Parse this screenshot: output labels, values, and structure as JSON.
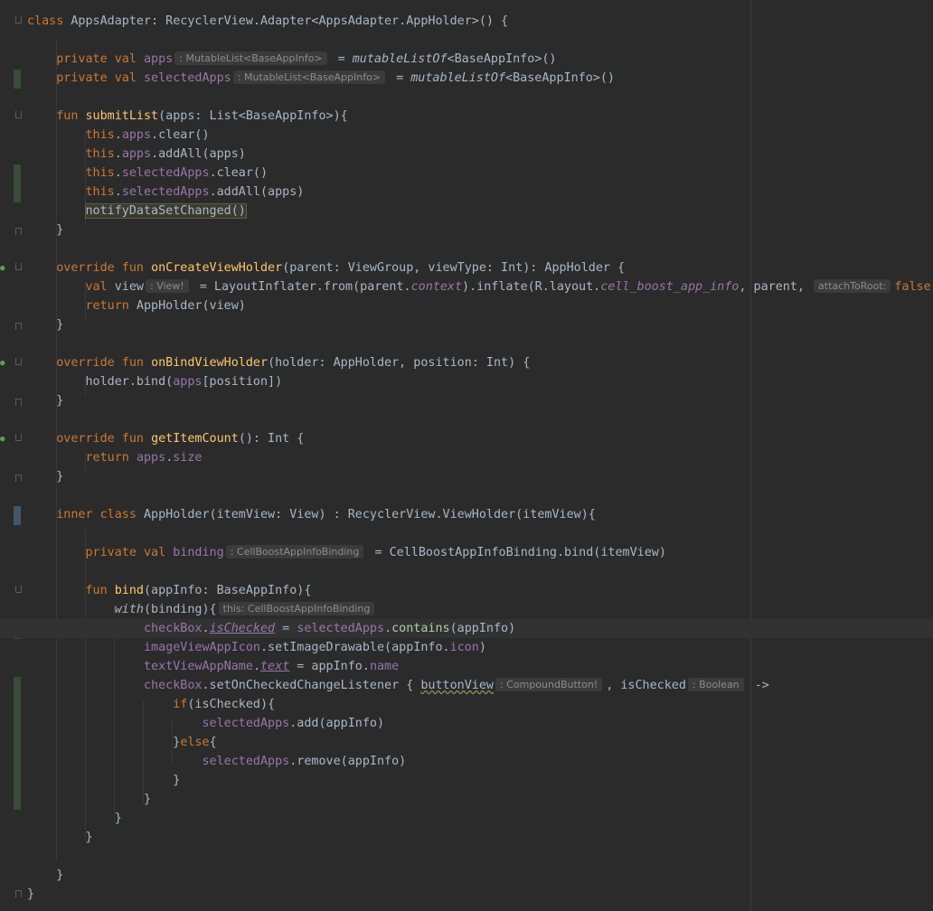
{
  "editor": {
    "title": "",
    "theme_colors": {
      "background": "#2b2b2b",
      "keyword": "#cc7832",
      "function": "#ffc66d",
      "property": "#9876aa",
      "text": "#a9b7c6",
      "hint_bg": "#3b3b3b",
      "vcs_added": "#384c38"
    }
  },
  "hints": {
    "apps_type": ": MutableList<BaseAppInfo>",
    "selected_type": ": MutableList<BaseAppInfo>",
    "view_type": ": View!",
    "attach_to_root": "attachToRoot:",
    "binding_type": ": CellBoostAppInfoBinding",
    "this_type": "this: CellBoostAppInfoBinding",
    "button_view_type": ": CompoundButton!",
    "is_checked_type": ": Boolean"
  },
  "text": {
    "l1_class": "class ",
    "l1_rest": "AppsAdapter: RecyclerView.Adapter<AppsAdapter.AppHolder>() {",
    "l3_priv": "private val ",
    "l3_name": "apps",
    "l3_eq": " = ",
    "l3_call": "mutableListOf",
    "l3_end": "<BaseAppInfo>()",
    "l4_priv": "private val ",
    "l4_name": "selectedApps",
    "l4_eq": " = ",
    "l4_call": "mutableListOf",
    "l4_end": "<BaseAppInfo>()",
    "l6_fun": "fun ",
    "l6_name": "submitList",
    "l6_rest": "(apps: List<BaseAppInfo>){",
    "l7_this": "this",
    "l7_dot": ".",
    "l7_prop": "apps",
    "l7_end": ".clear()",
    "l8_this": "this",
    "l8_dot": ".",
    "l8_prop": "apps",
    "l8_end": ".addAll(apps)",
    "l9_this": "this",
    "l9_dot": ".",
    "l9_prop": "selectedApps",
    "l9_end": ".clear()",
    "l10_this": "this",
    "l10_dot": ".",
    "l10_prop": "selectedApps",
    "l10_end": ".addAll(apps)",
    "l11_call": "notifyDataSetChanged()",
    "close": "}",
    "l14_kw": "override fun ",
    "l14_name": "onCreateViewHolder",
    "l14_rest": "(parent: ViewGroup, viewType: Int): AppHolder {",
    "l15_val": "val ",
    "l15_name": "view",
    "l15_a": " = LayoutInflater.from(parent.",
    "l15_ctx": "context",
    "l15_b": ").inflate(R.layout.",
    "l15_res": "cell_boost_app_info",
    "l15_c": ", parent, ",
    "l15_false": "false",
    "l15_d": ")",
    "l16_ret": "return ",
    "l16_rest": "AppHolder(view)",
    "l19_kw": "override fun ",
    "l19_name": "onBindViewHolder",
    "l19_rest": "(holder: AppHolder, position: Int) {",
    "l20_a": "holder.bind(",
    "l20_prop": "apps",
    "l20_b": "[position])",
    "l23_kw": "override fun ",
    "l23_name": "getItemCount",
    "l23_rest": "(): Int {",
    "l24_ret": "return ",
    "l24_prop": "apps",
    "l24_dot": ".",
    "l24_size": "size",
    "l27_kw": "inner class ",
    "l27_rest": "AppHolder(itemView: View) : RecyclerView.ViewHolder(itemView){",
    "l29_priv": "private val ",
    "l29_name": "binding",
    "l29_rest": " = CellBoostAppInfoBinding.bind(itemView)",
    "l31_fun": "fun ",
    "l31_name": "bind",
    "l31_rest": "(appInfo: BaseAppInfo){",
    "l32_with": "with",
    "l32_rest": "(binding){",
    "l33_cb": "checkBox",
    "l33_dot": ".",
    "l33_is": "isChecked",
    "l33_eq": " = ",
    "l33_sel": "selectedApps",
    "l33_dot2": ".",
    "l33_contains": "contains",
    "l33_end": "(appInfo)",
    "l34_icon": "imageViewAppIcon",
    "l34_a": ".setImageDrawable(appInfo.",
    "l34_prop": "icon",
    "l34_b": ")",
    "l35_name": "textViewAppName",
    "l35_dot": ".",
    "l35_text": "text",
    "l35_a": " = appInfo.",
    "l35_prop": "name",
    "l36_cb": "checkBox",
    "l36_a": ".setOnCheckedChangeListener { ",
    "l36_bv": "buttonView",
    "l36_b": ", isChecked",
    "l36_arrow": " ->",
    "l37_if": "if",
    "l37_rest": "(isChecked){",
    "l38_sel": "selectedApps",
    "l38_rest": ".add(appInfo)",
    "l39_a": "}",
    "l39_else": "else",
    "l39_b": "{",
    "l40_sel": "selectedApps",
    "l40_rest": ".remove(appInfo)"
  }
}
